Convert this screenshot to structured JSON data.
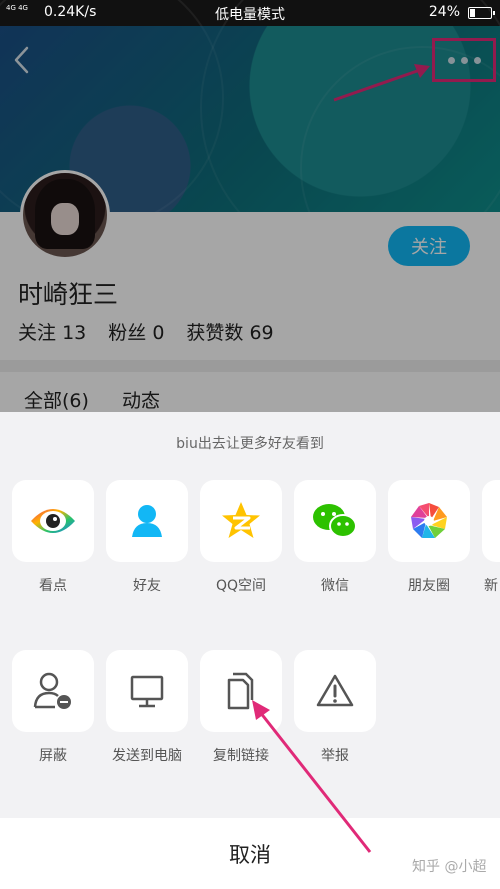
{
  "status_bar": {
    "network": "4G 4G",
    "speed": "0.24K/s",
    "mode": "低电量模式",
    "battery_percent_text": "24%",
    "battery_level": 0.24
  },
  "profile": {
    "follow_label": "关注",
    "name": "时崎狂三",
    "stats": {
      "following_label": "关注",
      "following_value": "13",
      "fans_label": "粉丝",
      "fans_value": "0",
      "likes_label": "获赞数",
      "likes_value": "69"
    },
    "tabs": [
      "全部(6)",
      "动态"
    ]
  },
  "share_sheet": {
    "title": "biu出去让更多好友看到",
    "row1": [
      {
        "label": "看点",
        "icon": "eye-icon"
      },
      {
        "label": "好友",
        "icon": "person-icon"
      },
      {
        "label": "QQ空间",
        "icon": "qzone-star-icon"
      },
      {
        "label": "微信",
        "icon": "wechat-icon"
      },
      {
        "label": "朋友圈",
        "icon": "moments-aperture-icon"
      },
      {
        "label": "新",
        "icon": "partial-icon"
      }
    ],
    "row2": [
      {
        "label": "屏蔽",
        "icon": "block-user-icon"
      },
      {
        "label": "发送到电脑",
        "icon": "monitor-icon"
      },
      {
        "label": "复制链接",
        "icon": "copy-icon"
      },
      {
        "label": "举报",
        "icon": "warning-icon"
      }
    ],
    "cancel_label": "取消"
  },
  "watermark": "知乎 @小超",
  "colors": {
    "accent": "#12b7f5",
    "highlight": "#e02a78",
    "sheet_bg": "#f2f2f4"
  }
}
